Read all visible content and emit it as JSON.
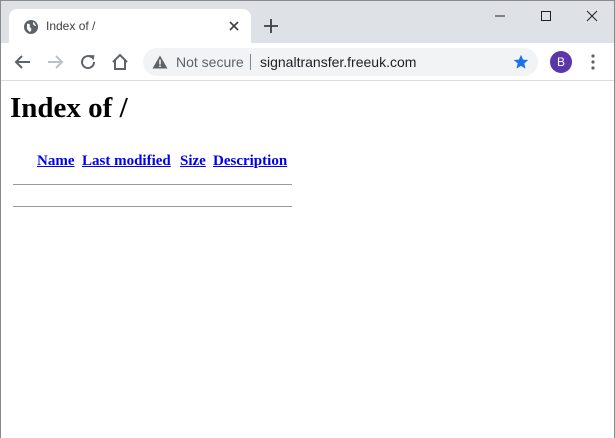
{
  "tab": {
    "title": "Index of /",
    "globe_icon": "globe-icon",
    "close_icon": "close-icon"
  },
  "window_controls": {
    "minimize_icon": "minimize-icon",
    "maximize_icon": "maximize-icon",
    "close_icon": "close-icon"
  },
  "toolbar": {
    "security_label": "Not secure",
    "url": "signaltransfer.freeuk.com",
    "avatar_letter": "B",
    "colors": {
      "star": "#1a73e8",
      "avatar": "#5a36a8"
    }
  },
  "page": {
    "heading": "Index of /",
    "columns": [
      "Name",
      "Last modified",
      "Size",
      "Description"
    ]
  }
}
